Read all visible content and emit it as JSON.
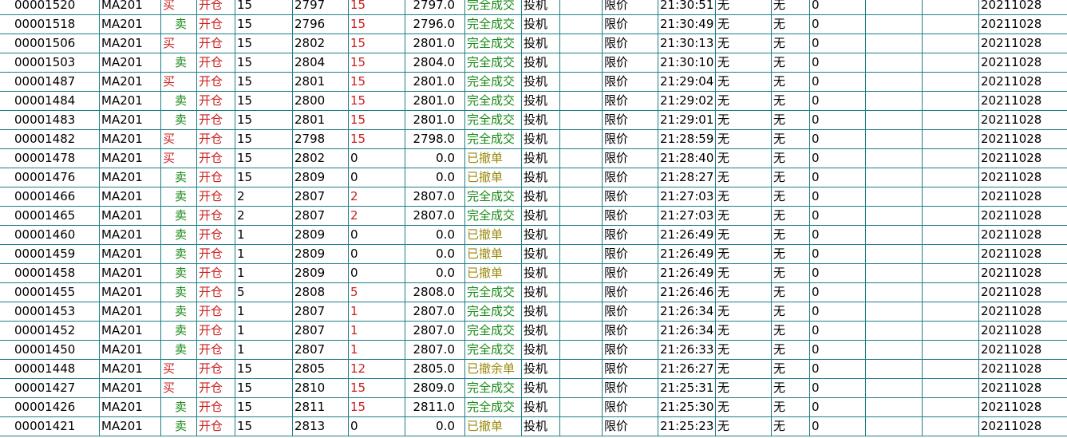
{
  "columns": [
    "order_id",
    "contract",
    "direction",
    "offset",
    "qty",
    "price",
    "filled_qty",
    "avg_price",
    "status",
    "hedge",
    "extra1",
    "price_type",
    "time",
    "flag1",
    "flag2",
    "zero",
    "extra2",
    "extra3",
    "date"
  ],
  "colors": {
    "grid_line": "#1d7f86",
    "buy": "#cc1f1f",
    "sell": "#178a17",
    "filled": "#178a17",
    "cancelled": "#9a8a10",
    "offset": "#cc1f1f",
    "filled_qty": "#cc1f1f"
  },
  "rows": [
    {
      "id": "00001520",
      "code": "MA201",
      "dir": "买",
      "off": "开仓",
      "qty": "15",
      "price": "2797",
      "fq": "15",
      "fp": "2797.0",
      "st": "完全成交",
      "hd": "投机",
      "tp": "限价",
      "tm": "21:30:51",
      "n1": "无",
      "n2": "无",
      "z": "0",
      "dt": "20211028"
    },
    {
      "id": "00001518",
      "code": "MA201",
      "dir": "卖",
      "off": "开仓",
      "qty": "15",
      "price": "2796",
      "fq": "15",
      "fp": "2796.0",
      "st": "完全成交",
      "hd": "投机",
      "tp": "限价",
      "tm": "21:30:49",
      "n1": "无",
      "n2": "无",
      "z": "0",
      "dt": "20211028"
    },
    {
      "id": "00001506",
      "code": "MA201",
      "dir": "买",
      "off": "开仓",
      "qty": "15",
      "price": "2802",
      "fq": "15",
      "fp": "2801.0",
      "st": "完全成交",
      "hd": "投机",
      "tp": "限价",
      "tm": "21:30:13",
      "n1": "无",
      "n2": "无",
      "z": "0",
      "dt": "20211028"
    },
    {
      "id": "00001503",
      "code": "MA201",
      "dir": "卖",
      "off": "开仓",
      "qty": "15",
      "price": "2804",
      "fq": "15",
      "fp": "2804.0",
      "st": "完全成交",
      "hd": "投机",
      "tp": "限价",
      "tm": "21:30:10",
      "n1": "无",
      "n2": "无",
      "z": "0",
      "dt": "20211028"
    },
    {
      "id": "00001487",
      "code": "MA201",
      "dir": "买",
      "off": "开仓",
      "qty": "15",
      "price": "2801",
      "fq": "15",
      "fp": "2801.0",
      "st": "完全成交",
      "hd": "投机",
      "tp": "限价",
      "tm": "21:29:04",
      "n1": "无",
      "n2": "无",
      "z": "0",
      "dt": "20211028"
    },
    {
      "id": "00001484",
      "code": "MA201",
      "dir": "卖",
      "off": "开仓",
      "qty": "15",
      "price": "2800",
      "fq": "15",
      "fp": "2801.0",
      "st": "完全成交",
      "hd": "投机",
      "tp": "限价",
      "tm": "21:29:02",
      "n1": "无",
      "n2": "无",
      "z": "0",
      "dt": "20211028"
    },
    {
      "id": "00001483",
      "code": "MA201",
      "dir": "卖",
      "off": "开仓",
      "qty": "15",
      "price": "2801",
      "fq": "15",
      "fp": "2801.0",
      "st": "完全成交",
      "hd": "投机",
      "tp": "限价",
      "tm": "21:29:01",
      "n1": "无",
      "n2": "无",
      "z": "0",
      "dt": "20211028"
    },
    {
      "id": "00001482",
      "code": "MA201",
      "dir": "买",
      "off": "开仓",
      "qty": "15",
      "price": "2798",
      "fq": "15",
      "fp": "2798.0",
      "st": "完全成交",
      "hd": "投机",
      "tp": "限价",
      "tm": "21:28:59",
      "n1": "无",
      "n2": "无",
      "z": "0",
      "dt": "20211028"
    },
    {
      "id": "00001478",
      "code": "MA201",
      "dir": "买",
      "off": "开仓",
      "qty": "15",
      "price": "2802",
      "fq": "0",
      "fp": "0.0",
      "st": "已撤单",
      "hd": "投机",
      "tp": "限价",
      "tm": "21:28:40",
      "n1": "无",
      "n2": "无",
      "z": "0",
      "dt": "20211028"
    },
    {
      "id": "00001476",
      "code": "MA201",
      "dir": "卖",
      "off": "开仓",
      "qty": "15",
      "price": "2809",
      "fq": "0",
      "fp": "0.0",
      "st": "已撤单",
      "hd": "投机",
      "tp": "限价",
      "tm": "21:28:27",
      "n1": "无",
      "n2": "无",
      "z": "0",
      "dt": "20211028"
    },
    {
      "id": "00001466",
      "code": "MA201",
      "dir": "卖",
      "off": "开仓",
      "qty": "2",
      "price": "2807",
      "fq": "2",
      "fp": "2807.0",
      "st": "完全成交",
      "hd": "投机",
      "tp": "限价",
      "tm": "21:27:03",
      "n1": "无",
      "n2": "无",
      "z": "0",
      "dt": "20211028"
    },
    {
      "id": "00001465",
      "code": "MA201",
      "dir": "卖",
      "off": "开仓",
      "qty": "2",
      "price": "2807",
      "fq": "2",
      "fp": "2807.0",
      "st": "完全成交",
      "hd": "投机",
      "tp": "限价",
      "tm": "21:27:03",
      "n1": "无",
      "n2": "无",
      "z": "0",
      "dt": "20211028"
    },
    {
      "id": "00001460",
      "code": "MA201",
      "dir": "卖",
      "off": "开仓",
      "qty": "1",
      "price": "2809",
      "fq": "0",
      "fp": "0.0",
      "st": "已撤单",
      "hd": "投机",
      "tp": "限价",
      "tm": "21:26:49",
      "n1": "无",
      "n2": "无",
      "z": "0",
      "dt": "20211028"
    },
    {
      "id": "00001459",
      "code": "MA201",
      "dir": "卖",
      "off": "开仓",
      "qty": "1",
      "price": "2809",
      "fq": "0",
      "fp": "0.0",
      "st": "已撤单",
      "hd": "投机",
      "tp": "限价",
      "tm": "21:26:49",
      "n1": "无",
      "n2": "无",
      "z": "0",
      "dt": "20211028"
    },
    {
      "id": "00001458",
      "code": "MA201",
      "dir": "卖",
      "off": "开仓",
      "qty": "1",
      "price": "2809",
      "fq": "0",
      "fp": "0.0",
      "st": "已撤单",
      "hd": "投机",
      "tp": "限价",
      "tm": "21:26:49",
      "n1": "无",
      "n2": "无",
      "z": "0",
      "dt": "20211028"
    },
    {
      "id": "00001455",
      "code": "MA201",
      "dir": "卖",
      "off": "开仓",
      "qty": "5",
      "price": "2808",
      "fq": "5",
      "fp": "2808.0",
      "st": "完全成交",
      "hd": "投机",
      "tp": "限价",
      "tm": "21:26:46",
      "n1": "无",
      "n2": "无",
      "z": "0",
      "dt": "20211028"
    },
    {
      "id": "00001453",
      "code": "MA201",
      "dir": "卖",
      "off": "开仓",
      "qty": "1",
      "price": "2807",
      "fq": "1",
      "fp": "2807.0",
      "st": "完全成交",
      "hd": "投机",
      "tp": "限价",
      "tm": "21:26:34",
      "n1": "无",
      "n2": "无",
      "z": "0",
      "dt": "20211028"
    },
    {
      "id": "00001452",
      "code": "MA201",
      "dir": "卖",
      "off": "开仓",
      "qty": "1",
      "price": "2807",
      "fq": "1",
      "fp": "2807.0",
      "st": "完全成交",
      "hd": "投机",
      "tp": "限价",
      "tm": "21:26:34",
      "n1": "无",
      "n2": "无",
      "z": "0",
      "dt": "20211028"
    },
    {
      "id": "00001450",
      "code": "MA201",
      "dir": "卖",
      "off": "开仓",
      "qty": "1",
      "price": "2807",
      "fq": "1",
      "fp": "2807.0",
      "st": "完全成交",
      "hd": "投机",
      "tp": "限价",
      "tm": "21:26:33",
      "n1": "无",
      "n2": "无",
      "z": "0",
      "dt": "20211028"
    },
    {
      "id": "00001448",
      "code": "MA201",
      "dir": "买",
      "off": "开仓",
      "qty": "15",
      "price": "2805",
      "fq": "12",
      "fp": "2805.0",
      "st": "已撤余单",
      "hd": "投机",
      "tp": "限价",
      "tm": "21:26:27",
      "n1": "无",
      "n2": "无",
      "z": "0",
      "dt": "20211028"
    },
    {
      "id": "00001427",
      "code": "MA201",
      "dir": "买",
      "off": "开仓",
      "qty": "15",
      "price": "2810",
      "fq": "15",
      "fp": "2809.0",
      "st": "完全成交",
      "hd": "投机",
      "tp": "限价",
      "tm": "21:25:31",
      "n1": "无",
      "n2": "无",
      "z": "0",
      "dt": "20211028"
    },
    {
      "id": "00001426",
      "code": "MA201",
      "dir": "卖",
      "off": "开仓",
      "qty": "15",
      "price": "2811",
      "fq": "15",
      "fp": "2811.0",
      "st": "完全成交",
      "hd": "投机",
      "tp": "限价",
      "tm": "21:25:30",
      "n1": "无",
      "n2": "无",
      "z": "0",
      "dt": "20211028"
    },
    {
      "id": "00001421",
      "code": "MA201",
      "dir": "卖",
      "off": "开仓",
      "qty": "15",
      "price": "2813",
      "fq": "0",
      "fp": "0.0",
      "st": "已撤单",
      "hd": "投机",
      "tp": "限价",
      "tm": "21:25:23",
      "n1": "无",
      "n2": "无",
      "z": "0",
      "dt": "20211028"
    }
  ]
}
